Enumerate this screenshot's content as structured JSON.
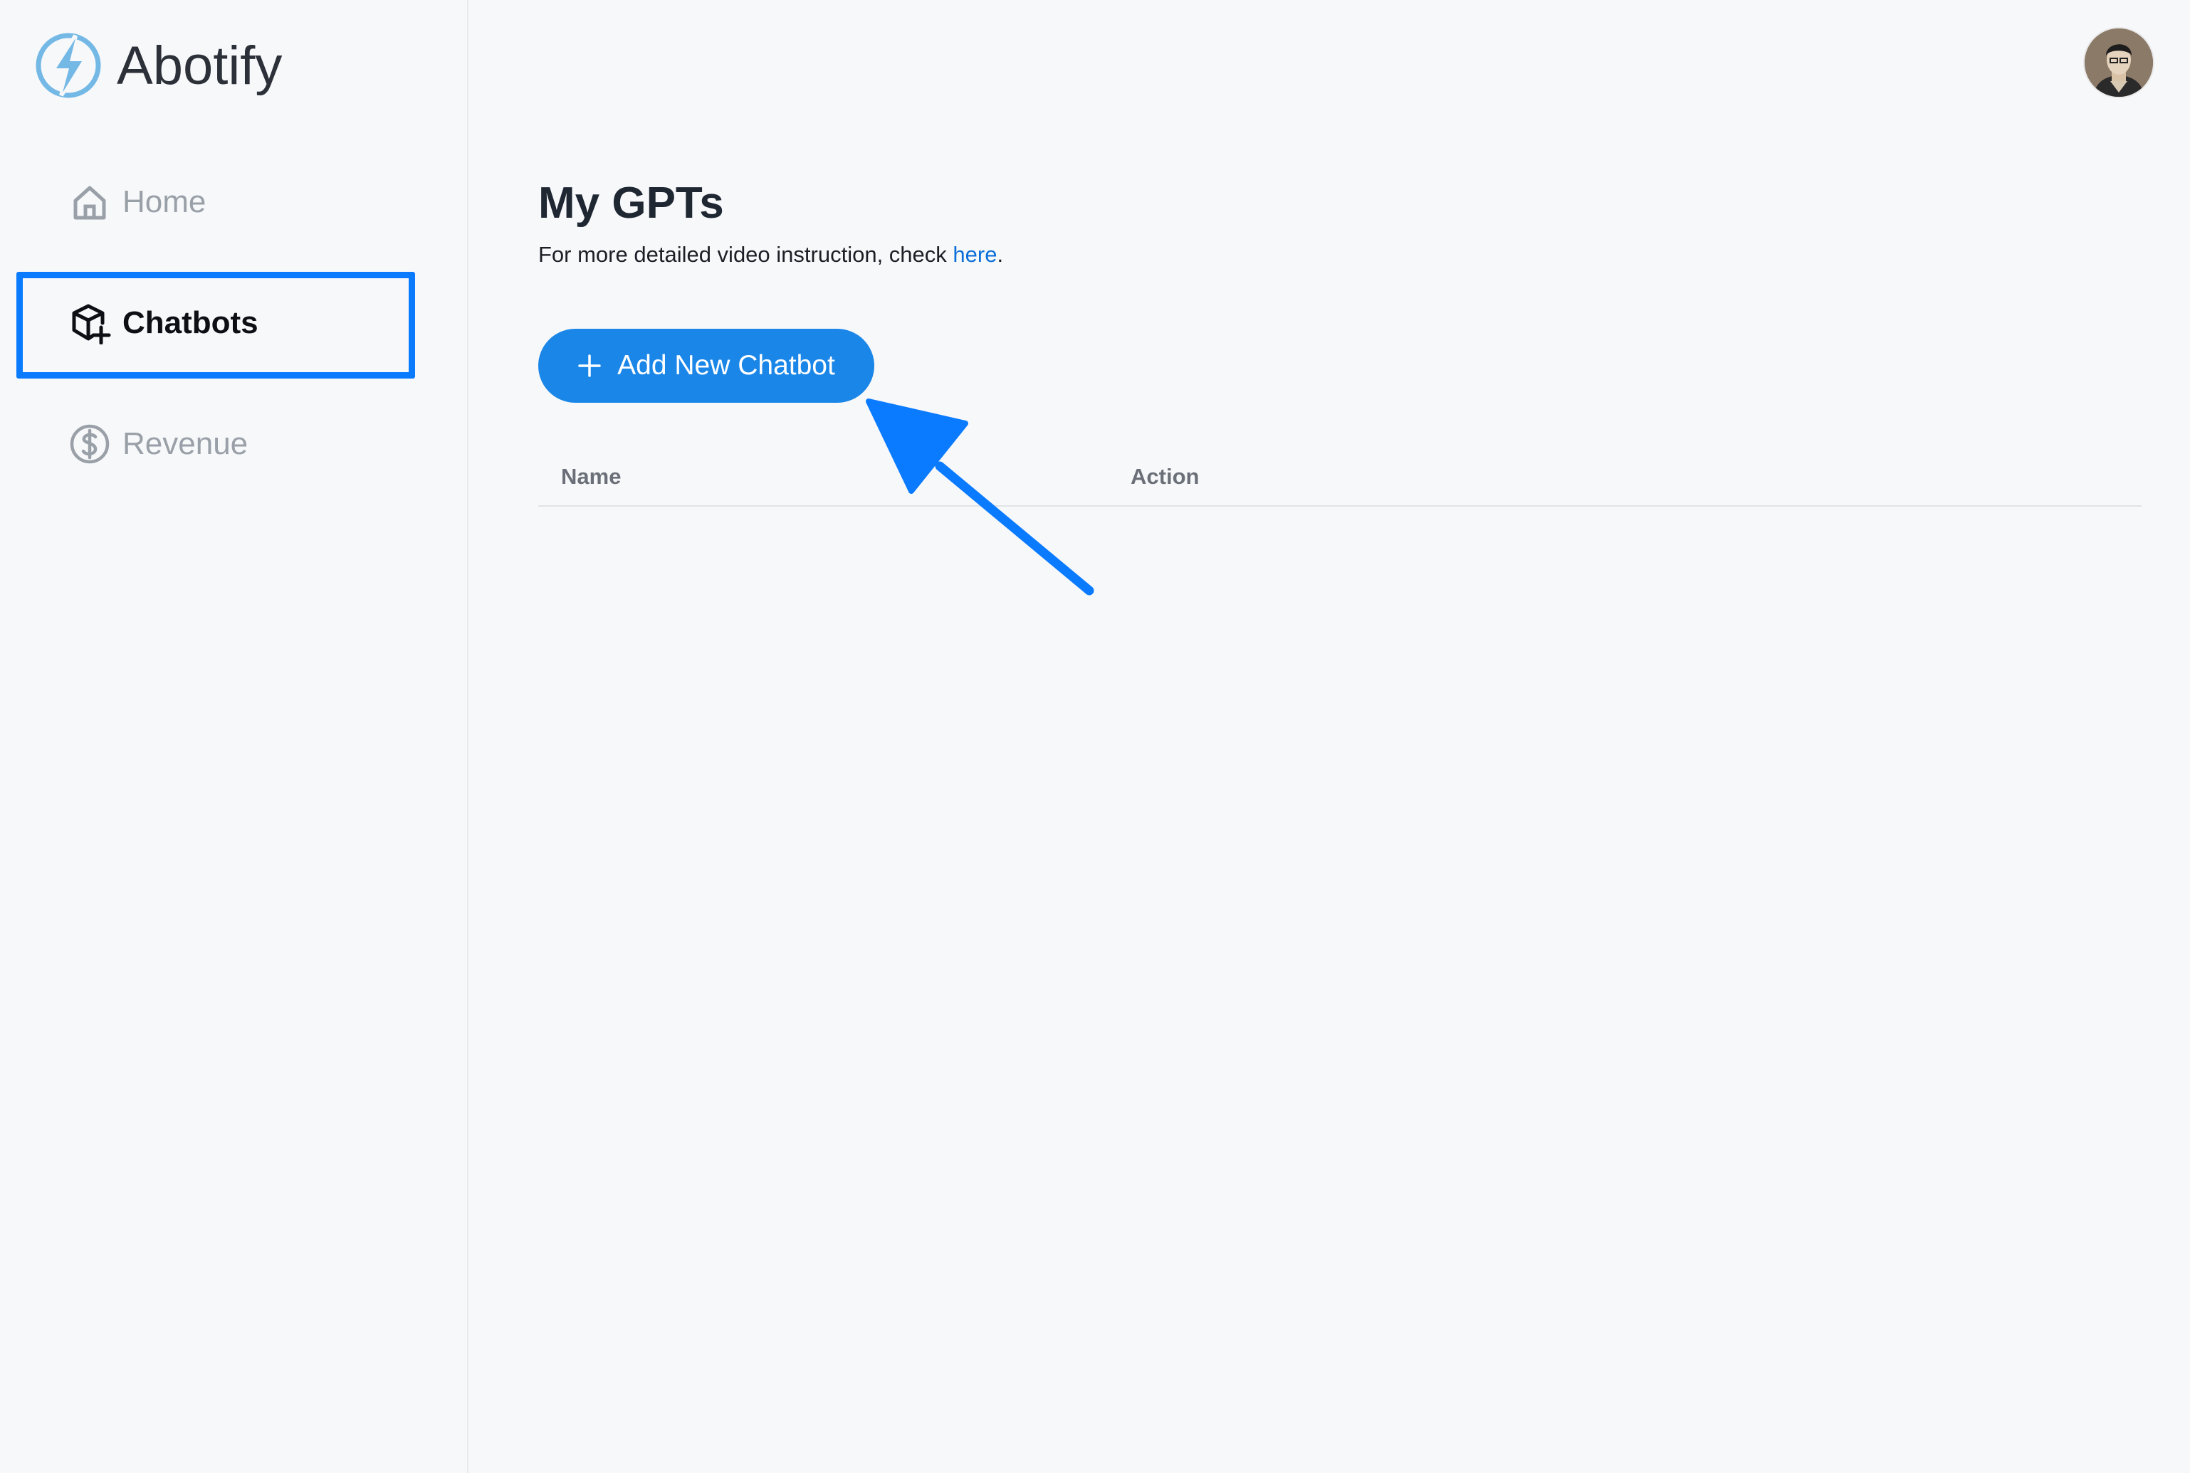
{
  "app": {
    "name": "Abotify",
    "logo_icon": "lightning-bolt-icon",
    "accent_color": "#1a86e8",
    "highlight_color": "#0a7bff"
  },
  "sidebar": {
    "items": [
      {
        "label": "Home",
        "icon": "home-icon",
        "active": false
      },
      {
        "label": "Chatbots",
        "icon": "cube-plus-icon",
        "active": true
      },
      {
        "label": "Revenue",
        "icon": "dollar-circle-icon",
        "active": false
      }
    ]
  },
  "header": {
    "avatar_icon": "user-avatar"
  },
  "main": {
    "title": "My GPTs",
    "subtitle_prefix": "For more detailed video instruction, check ",
    "subtitle_link": "here",
    "subtitle_suffix": ".",
    "add_button_label": "Add New Chatbot",
    "add_button_icon": "plus-icon",
    "table": {
      "columns": [
        "Name",
        "Action"
      ],
      "rows": []
    }
  },
  "annotations": {
    "arrow_icon": "pointer-arrow-icon",
    "highlight": "Chatbots"
  }
}
